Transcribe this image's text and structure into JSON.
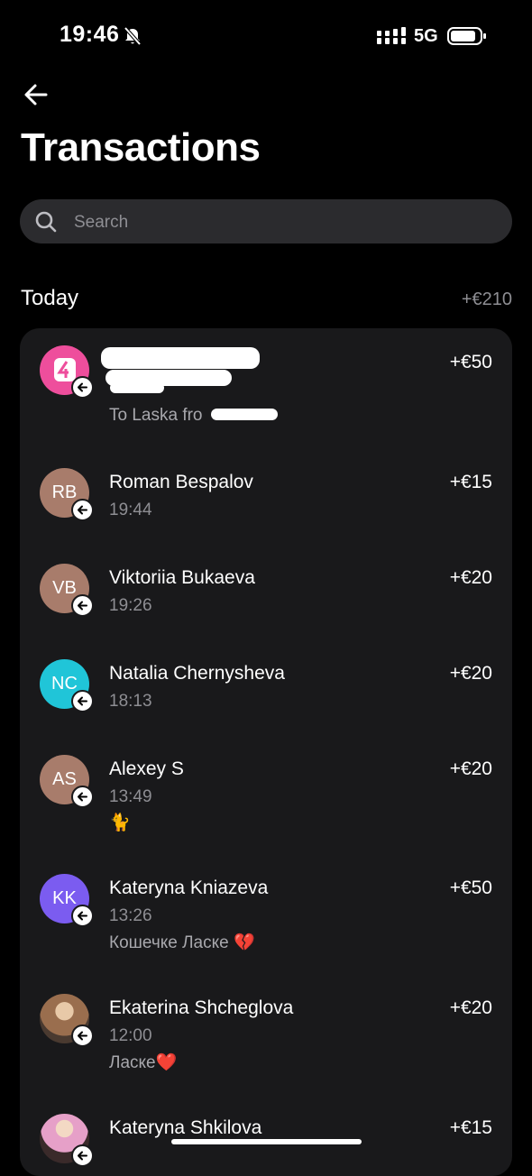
{
  "status": {
    "time": "19:46",
    "network": "5G"
  },
  "header": {
    "title": "Transactions"
  },
  "search": {
    "placeholder": "Search"
  },
  "section": {
    "label": "Today",
    "total": "+€210"
  },
  "colors": {
    "background": "#000000",
    "card": "#19191b",
    "secondary_text": "#8e8e93"
  },
  "transactions": [
    {
      "name": "",
      "time": "",
      "note": "To Laska fro",
      "amount": "+€50",
      "avatar_color": "#ee4e9c",
      "avatar": "pink-app-logo"
    },
    {
      "name": "Roman Bespalov",
      "time": "19:44",
      "note": "",
      "amount": "+€15",
      "initials": "RB",
      "avatar_color": "#a87c6b"
    },
    {
      "name": "Viktoriia Bukaeva",
      "time": "19:26",
      "note": "",
      "amount": "+€20",
      "initials": "VB",
      "avatar_color": "#a87c6b"
    },
    {
      "name": "Natalia Chernysheva",
      "time": "18:13",
      "note": "",
      "amount": "+€20",
      "initials": "NC",
      "avatar_color": "#20c5d8"
    },
    {
      "name": "Alexey S",
      "time": "13:49",
      "note": "🐈",
      "amount": "+€20",
      "initials": "AS",
      "avatar_color": "#a87c6b"
    },
    {
      "name": "Kateryna Kniazeva",
      "time": "13:26",
      "note": "Кошечке Ласке 💔",
      "amount": "+€50",
      "initials": "KK",
      "avatar_color": "#7b5cf0"
    },
    {
      "name": "Ekaterina Shcheglova",
      "time": "12:00",
      "note": "Ласке❤️",
      "amount": "+€20",
      "avatar": "photo",
      "avatar_color": "#8a6a55"
    },
    {
      "name": "Kateryna Shkilova",
      "time": "",
      "note": "",
      "amount": "+€15",
      "avatar": "photo",
      "avatar_color": "#c97aa8"
    }
  ]
}
